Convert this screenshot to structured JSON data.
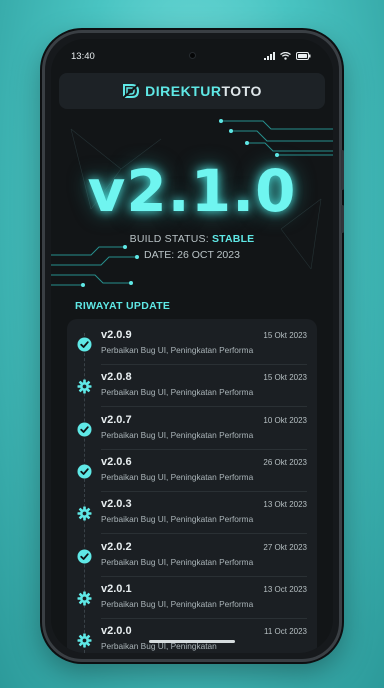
{
  "status_bar": {
    "time": "13:40",
    "icons": [
      "signal-icon",
      "wifi-icon",
      "battery-icon"
    ]
  },
  "header": {
    "brand_part1": "DIREKTUR",
    "brand_part2": "TOTO",
    "logo_icon": "direkturtoto-logo-icon"
  },
  "hero": {
    "version": "v2.1.0",
    "build_label": "BUILD STATUS:",
    "build_value": "STABLE",
    "date": "DATE: 26 OCT 2023"
  },
  "history": {
    "title": "RIWAYAT UPDATE",
    "items": [
      {
        "version": "v2.0.9",
        "date": "15 Okt 2023",
        "desc": "Perbaikan Bug UI, Peningkatan Performa",
        "icon": "check-icon"
      },
      {
        "version": "v2.0.8",
        "date": "15 Okt 2023",
        "desc": "Perbaikan Bug UI, Peningkatan Performa",
        "icon": "gear-icon"
      },
      {
        "version": "v2.0.7",
        "date": "10 Okt 2023",
        "desc": "Perbaikan Bug UI, Peningkatan Performa",
        "icon": "check-icon"
      },
      {
        "version": "v2.0.6",
        "date": "26 Okt 2023",
        "desc": "Perbaikan Bug UI, Peningkatan Performa",
        "icon": "check-icon"
      },
      {
        "version": "v2.0.3",
        "date": "13 Okt 2023",
        "desc": "Perbaikan Bug UI, Peningkatan Performa",
        "icon": "gear-icon"
      },
      {
        "version": "v2.0.2",
        "date": "27 Okt 2023",
        "desc": "Perbaikan Bug UI, Peningkatan Performa",
        "icon": "check-icon"
      },
      {
        "version": "v2.0.1",
        "date": "13 Oct 2023",
        "desc": "Perbaikan Bug UI, Peningkatan Performa",
        "icon": "gear-icon"
      },
      {
        "version": "v2.0.0",
        "date": "11 Oct 2023",
        "desc": "Perbaikan Bug UI, Peningkatan",
        "icon": "gear-icon"
      }
    ]
  },
  "colors": {
    "accent": "#5fe8e6",
    "background": "#121517",
    "card": "#1b1f23"
  }
}
